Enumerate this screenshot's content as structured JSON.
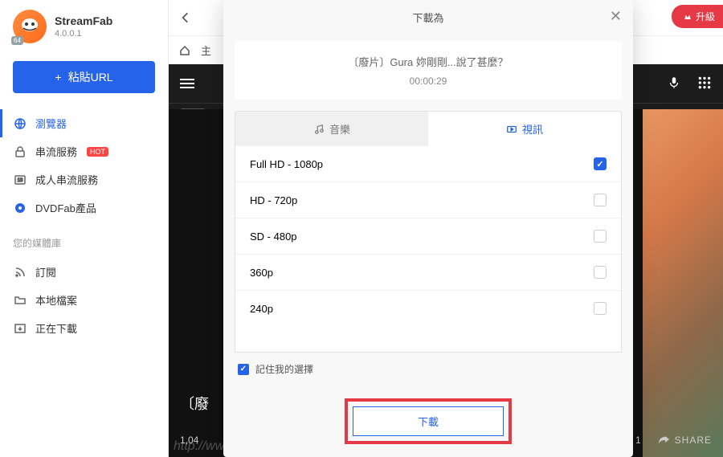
{
  "app": {
    "name": "StreamFab",
    "version": "4.0.0.1"
  },
  "paste_button": "粘貼URL",
  "nav": {
    "browser": "瀏覽器",
    "streaming": "串流服務",
    "streaming_badge": "HOT",
    "adult": "成人串流服務",
    "dvdfab": "DVDFab產品"
  },
  "library_label": "您的媒體庫",
  "library": {
    "subscribe": "訂閱",
    "local": "本地檔案",
    "downloading": "正在下載"
  },
  "topbar": {
    "home_partial": "主"
  },
  "upgrade": "升級",
  "video": {
    "title_partial": "〔廢",
    "views_partial": "1,04",
    "like_count": "1",
    "share": "SHARE"
  },
  "watermark": "http://www.xiaoyao.tw",
  "modal": {
    "title": "下載為",
    "video_title": "〔廢片〕Gura 妳剛剛...說了甚麼？",
    "duration": "00:00:29",
    "tab_music": "音樂",
    "tab_video": "視訊",
    "qualities": [
      {
        "label": "Full HD - 1080p",
        "checked": true
      },
      {
        "label": "HD - 720p",
        "checked": false
      },
      {
        "label": "SD - 480p",
        "checked": false
      },
      {
        "label": "360p",
        "checked": false
      },
      {
        "label": "240p",
        "checked": false
      }
    ],
    "remember": "記住我的選擇",
    "download_btn": "下載"
  }
}
